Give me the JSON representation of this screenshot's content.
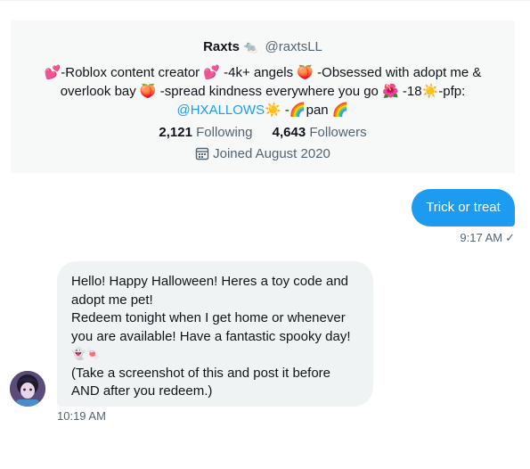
{
  "profile": {
    "display_name": "Raxts",
    "badge_icon": "rat-emoji-icon",
    "handle": "@raxtsLL",
    "bio_line1": "💕-Roblox content creator 💕 -4k+ angels 🍑 -Obsessed with adopt me &",
    "bio_line2": "overlook bay 🍑 -spread kindness everywhere you go 🌺 -18☀️-pfp:",
    "bio_link": "@HXALLOWS☀️",
    "bio_line3_rest": " -🌈pan 🌈",
    "following_count": "2,121",
    "following_label": "Following",
    "followers_count": "4,643",
    "followers_label": "Followers",
    "joined": "Joined August 2020"
  },
  "messages": [
    {
      "direction": "sent",
      "text": "Trick or treat",
      "time": "9:17 AM",
      "status_icon": "check-icon",
      "color": "#1d9bf0"
    },
    {
      "direction": "received",
      "lines": [
        "Hello! Happy Halloween! Heres a toy code and",
        "adopt me pet!",
        "Redeem tonight when I get home or whenever",
        "you are available! Have a fantastic spooky day!",
        "👻🍬",
        "(Take a screenshot of this and post it before",
        "AND after you redeem.)"
      ],
      "time": "10:19 AM"
    }
  ]
}
